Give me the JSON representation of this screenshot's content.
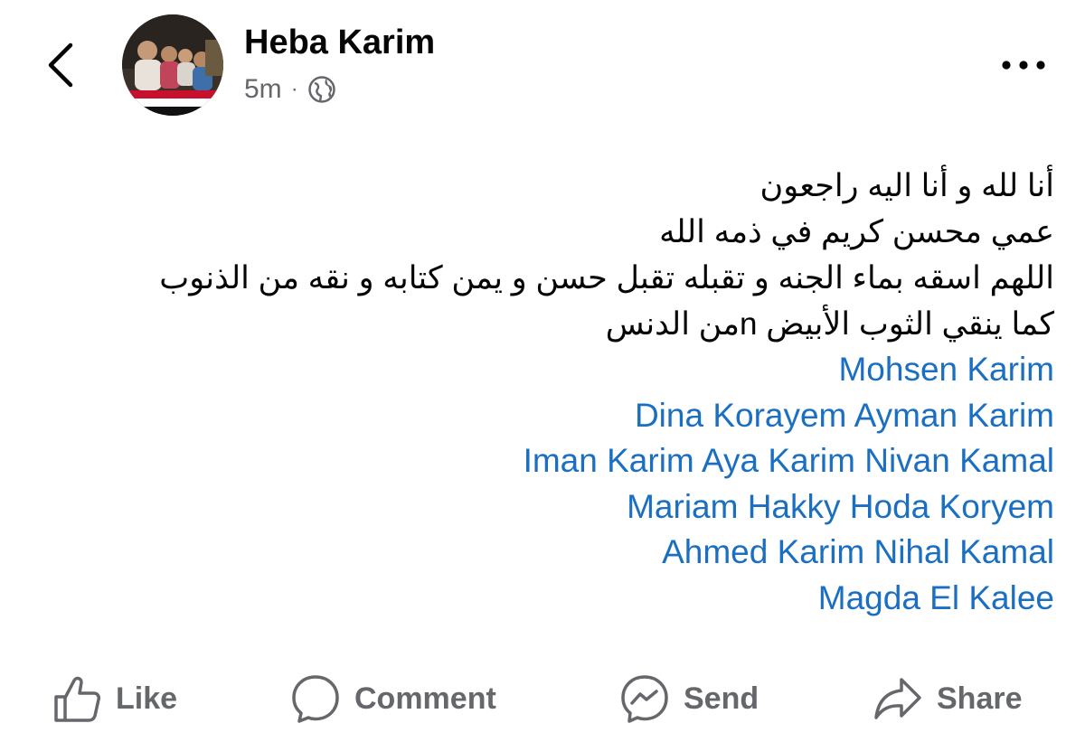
{
  "header": {
    "author_name": "Heba Karim",
    "time": "5m",
    "separator": "·",
    "privacy_icon": "globe-icon",
    "back_icon": "chevron-left-icon",
    "more_icon": "more-horizontal-icon"
  },
  "post": {
    "lines": [
      "أنا لله و أنا اليه راجعون",
      "عمي محسن كريم في ذمه الله",
      "اللهم اسقه بماء الجنه و تقبله تقبل حسن و يمن كتابه و نقه من الذنوب",
      "كما ينقي الثوب الأبيض    nمن الدنس"
    ],
    "tags": [
      "Mohsen Karim",
      "Dina Korayem Ayman Karim",
      "Iman Karim Aya Karim Nivan Kamal",
      "Mariam Hakky Hoda Koryem",
      "Ahmed Karim Nihal Kamal",
      "Magda El Kalee"
    ]
  },
  "actions": {
    "like": "Like",
    "comment": "Comment",
    "send": "Send",
    "share": "Share"
  },
  "colors": {
    "text": "#050505",
    "secondary": "#65676b",
    "link": "#1b6fc2"
  }
}
